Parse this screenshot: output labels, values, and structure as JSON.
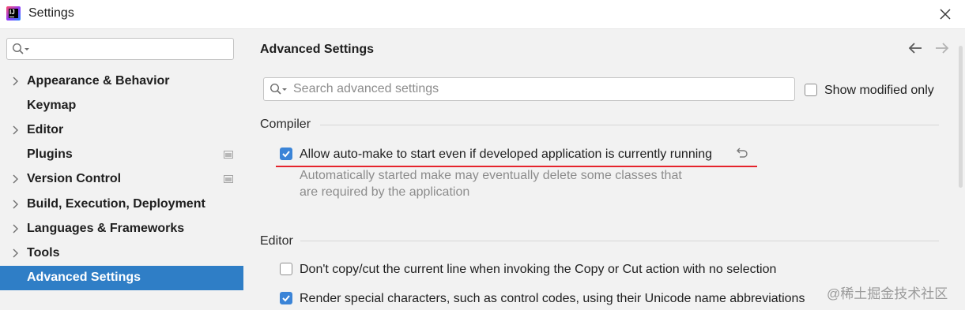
{
  "window": {
    "title": "Settings"
  },
  "sidebar": {
    "search_placeholder": "",
    "items": [
      {
        "label": "Appearance & Behavior",
        "expandable": true,
        "project_icon": false
      },
      {
        "label": "Keymap",
        "expandable": false,
        "project_icon": false
      },
      {
        "label": "Editor",
        "expandable": true,
        "project_icon": false
      },
      {
        "label": "Plugins",
        "expandable": false,
        "project_icon": true
      },
      {
        "label": "Version Control",
        "expandable": true,
        "project_icon": true
      },
      {
        "label": "Build, Execution, Deployment",
        "expandable": true,
        "project_icon": false
      },
      {
        "label": "Languages & Frameworks",
        "expandable": true,
        "project_icon": false
      },
      {
        "label": "Tools",
        "expandable": true,
        "project_icon": false
      },
      {
        "label": "Advanced Settings",
        "expandable": false,
        "project_icon": false,
        "selected": true
      }
    ]
  },
  "main": {
    "title": "Advanced Settings",
    "search": {
      "placeholder": "Search advanced settings",
      "value": ""
    },
    "show_modified": {
      "label": "Show modified only",
      "checked": false
    },
    "groups": [
      {
        "title": "Compiler",
        "options": [
          {
            "label": "Allow auto-make to start even if developed application is currently running",
            "checked": true,
            "description_lines": [
              "Automatically started make may eventually delete some classes that",
              "are required by the application"
            ]
          }
        ]
      },
      {
        "title": "Editor",
        "options": [
          {
            "label": "Don't copy/cut the current line when invoking the Copy or Cut action with no selection",
            "checked": false
          },
          {
            "label": "Render special characters, such as control codes, using their Unicode name abbreviations",
            "checked": true
          }
        ]
      }
    ]
  },
  "watermark": "@稀土掘金技术社区",
  "colors": {
    "selection": "#2f7ec6",
    "checkbox": "#3b84d7",
    "highlight_underline": "#e5232c"
  },
  "icons": [
    "search-icon",
    "close-icon",
    "chevron-right-icon",
    "project-icon",
    "arrow-left-icon",
    "arrow-right-icon",
    "reset-icon"
  ]
}
